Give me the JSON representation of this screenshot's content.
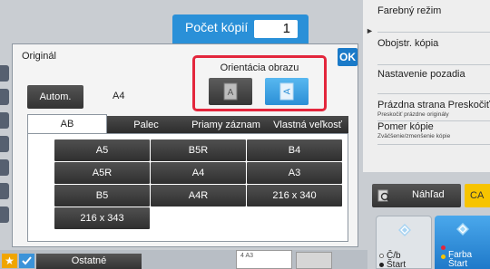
{
  "copies": {
    "label": "Počet kópií",
    "value": "1"
  },
  "dialog": {
    "title": "Originál",
    "ok_label": "OK",
    "orientation": {
      "label": "Orientácia obrazu",
      "portrait_glyph": "A",
      "landscape_glyph": "A",
      "selected": "landscape"
    },
    "auto_label": "Autom.",
    "paper_value": "A4",
    "tabs": [
      {
        "label": "AB",
        "selected": true
      },
      {
        "label": "Palec"
      },
      {
        "label": "Priamy záznam"
      },
      {
        "label": "Vlastná veľkosť"
      }
    ],
    "sizes": [
      "A5",
      "B5R",
      "B4",
      "A5R",
      "A4",
      "A3",
      "B5",
      "A4R",
      "216 x 340",
      "216 x 343"
    ]
  },
  "right_panel": {
    "items": [
      {
        "label": "Farebný režim"
      },
      {
        "label": "Obojstr. kópia"
      },
      {
        "label": "Nastavenie pozadia"
      },
      {
        "label": "Prázdna strana Preskočiť",
        "sub": "Preskočiť prázdne originály"
      },
      {
        "label": "Pomer kópie",
        "sub": "Zväčšenie/zmenšenie kópie"
      }
    ],
    "preview_label": "Náhľad",
    "ca_label": "CA",
    "start_bw": {
      "line1": "Č/b",
      "line2": "Štart"
    },
    "start_color": {
      "line1": "Farba",
      "line2": "Štart"
    }
  },
  "bottom_bar": {
    "others_label": "Ostatné",
    "thumb_text": "4    A3"
  },
  "colors": {
    "accent": "#2a90d8",
    "highlight": "#e3263c",
    "ca": "#f7c400",
    "star": "#f0a500"
  }
}
